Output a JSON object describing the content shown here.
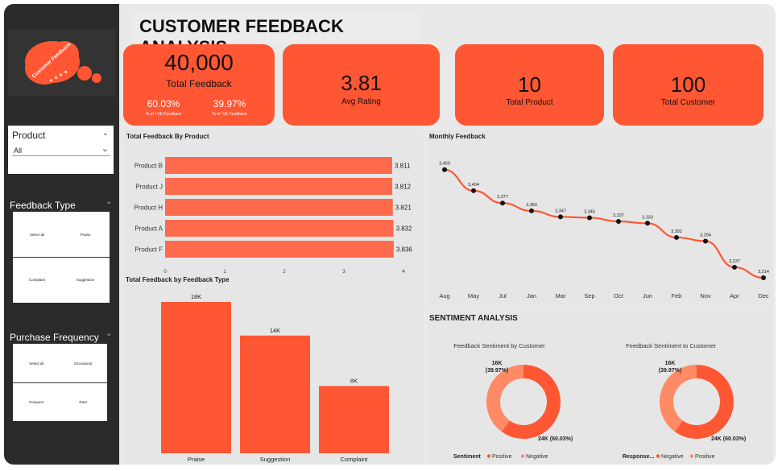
{
  "title": "CUSTOMER FEEDBACK ANALYSIS",
  "logo_text": "Customer Feedback",
  "filters": {
    "product": {
      "label": "Product",
      "value": "All"
    },
    "feedback_type": {
      "label": "Feedback Type",
      "options": [
        "Select all",
        "Praise",
        "Complaint",
        "Suggestion"
      ]
    },
    "purchase_frequency": {
      "label": "Purchase Frequency",
      "options": [
        "Select all",
        "Occasional",
        "Frequent",
        "Rare"
      ]
    }
  },
  "kpis": {
    "total_feedback": {
      "value": "40,000",
      "label": "Total Feedback",
      "pos_pct": "60.03%",
      "pos_label": "% of +VE Feedback",
      "neg_pct": "39.97%",
      "neg_label": "% of -VE Feedback"
    },
    "avg_rating": {
      "value": "3.81",
      "label": "Avg Rating"
    },
    "total_product": {
      "value": "10",
      "label": "Total Product"
    },
    "total_customer": {
      "value": "100",
      "label": "Total Customer"
    }
  },
  "colors": {
    "accent": "#ff5733",
    "bar": "#fd6a4c",
    "light": "#ff8a65",
    "dark_sidebar": "#2b2b2b"
  },
  "sentiment_section_title": "SENTIMENT ANALYSIS",
  "chart_data": [
    {
      "id": "product",
      "type": "bar",
      "orientation": "horizontal",
      "title": "Total Feedback By Product",
      "categories": [
        "Product B",
        "Product J",
        "Product H",
        "Product A",
        "Product F"
      ],
      "values": [
        3.811,
        3.812,
        3.821,
        3.832,
        3.836
      ],
      "xlim": [
        0,
        4
      ],
      "ticks": [
        0,
        1,
        2,
        3,
        4
      ]
    },
    {
      "id": "monthly",
      "type": "line",
      "title": "Monthly Feedback",
      "categories": [
        "Aug",
        "May",
        "Jul",
        "Jan",
        "Mar",
        "Sep",
        "Oct",
        "Jun",
        "Feb",
        "Nov",
        "Apr",
        "Dec"
      ],
      "values": [
        3450,
        3404,
        3377,
        3360,
        3347,
        3345,
        3337,
        3333,
        3302,
        3294,
        3237,
        3214
      ],
      "labels": [
        "3,450",
        "3,404",
        "3,377",
        "3,360",
        "3,347",
        "3,345",
        "3,337",
        "3,333",
        "3,302",
        "3,294",
        "3,237",
        "3,214"
      ],
      "ylim": [
        3200,
        3460
      ]
    },
    {
      "id": "feedback_type",
      "type": "bar",
      "title": "Total Feedback by Feedback Type",
      "categories": [
        "Praise",
        "Suggestion",
        "Complaint"
      ],
      "values": [
        18000,
        14000,
        8000
      ],
      "labels": [
        "18K",
        "14K",
        "8K"
      ],
      "ylim": [
        0,
        18000
      ]
    },
    {
      "id": "sentiment_by_customer",
      "type": "pie",
      "title": "Feedback Sentiment by Customer",
      "slices": [
        {
          "name": "Positive",
          "value": 60.03,
          "label": "24K (60.03%)",
          "color": "#ff5733"
        },
        {
          "name": "Negative",
          "value": 39.97,
          "label": "16K\n(39.97%)",
          "color": "#ff8a65"
        }
      ],
      "legend_title": "Sentiment",
      "legend": [
        "Positive",
        "Negative"
      ]
    },
    {
      "id": "sentiment_to_customer",
      "type": "pie",
      "title": "Feedback Sentiment to Customer",
      "slices": [
        {
          "name": "Negative",
          "value": 60.03,
          "label": "24K (60.03%)",
          "color": "#ff5733"
        },
        {
          "name": "Positive",
          "value": 39.97,
          "label": "16K\n(39.97%)",
          "color": "#ff8a65"
        }
      ],
      "legend_title": "Response...",
      "legend": [
        "Negative",
        "Positive"
      ]
    }
  ]
}
